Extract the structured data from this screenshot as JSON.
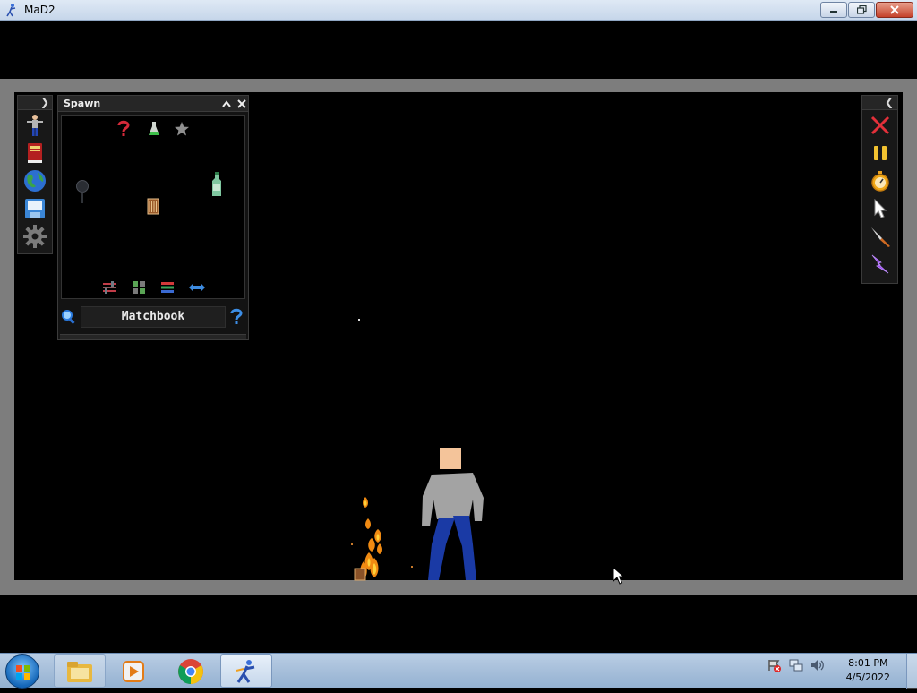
{
  "window": {
    "title": "MaD2",
    "minimize_icon": "minimize-icon",
    "maximize_icon": "restore-icon",
    "close_icon": "close-icon"
  },
  "tool_strip": {
    "collapse_icon": "chevron-right-icon",
    "tools": [
      "ragdoll-tool-icon",
      "book-icon",
      "globe-icon",
      "save-icon",
      "gear-icon"
    ]
  },
  "spawn_panel": {
    "title": "Spawn",
    "top_filters": [
      "question-icon",
      "flask-icon",
      "star-icon"
    ],
    "items": [
      "frying-pan-icon",
      "matchbook-icon",
      "bottle-icon"
    ],
    "bottom_filters": [
      "sliders-icon",
      "grid-icon",
      "list-icon",
      "swap-arrows-icon"
    ],
    "selected_item": "Matchbook",
    "search_icon": "magnifier-icon",
    "help_icon": "help-icon"
  },
  "right_toolbar": {
    "collapse_icon": "chevron-left-icon",
    "tools": [
      "clear-x-icon",
      "pause-icon",
      "stopwatch-icon",
      "pointer-icon",
      "knife-icon",
      "lightning-icon"
    ]
  },
  "scene": {
    "entities": [
      "ragdoll",
      "fire",
      "matchbook"
    ]
  },
  "taskbar": {
    "apps": [
      "file-explorer-icon",
      "media-player-icon",
      "chrome-icon",
      "mad2-icon"
    ],
    "time": "8:01 PM",
    "date": "4/5/2022"
  },
  "colors": {
    "panel_bg": "#131313",
    "arena_bg": "#000000",
    "frame_gray": "#7d7d7d",
    "ragdoll_shirt": "#a3a3a3",
    "ragdoll_pants": "#1a3aa5",
    "ragdoll_skin": "#f4c49a"
  }
}
